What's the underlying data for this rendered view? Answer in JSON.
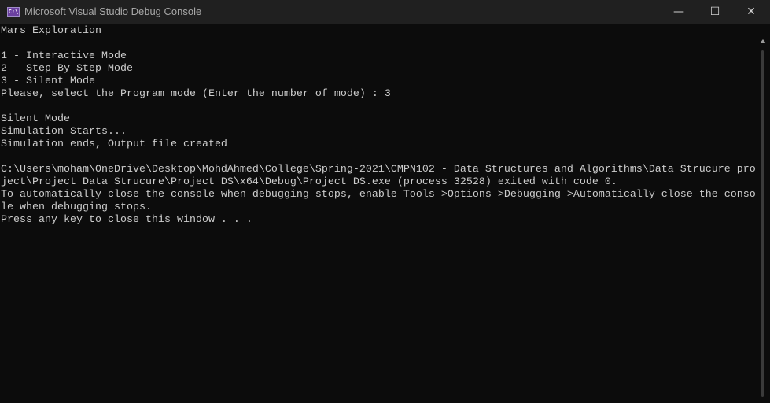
{
  "window": {
    "title": "Microsoft Visual Studio Debug Console",
    "icon": "console-icon",
    "icon_text": "C:\\",
    "controls": {
      "minimize": "—",
      "maximize": "☐",
      "close": "✕"
    }
  },
  "console": {
    "lines": [
      "Mars Exploration",
      "",
      "1 - Interactive Mode",
      "2 - Step-By-Step Mode",
      "3 - Silent Mode",
      "Please, select the Program mode (Enter the number of mode) : 3",
      "",
      "Silent Mode",
      "Simulation Starts...",
      "Simulation ends, Output file created",
      "",
      "C:\\Users\\moham\\OneDrive\\Desktop\\MohdAhmed\\College\\Spring-2021\\CMPN102 - Data Structures and Algorithms\\Data Strucure pro",
      "ject\\Project Data Strucure\\Project DS\\x64\\Debug\\Project DS.exe (process 32528) exited with code 0.",
      "To automatically close the console when debugging stops, enable Tools->Options->Debugging->Automatically close the conso",
      "le when debugging stops.",
      "Press any key to close this window . . ."
    ]
  },
  "colors": {
    "background": "#0c0c0c",
    "text": "#cccccc",
    "titlebar": "#202020"
  }
}
